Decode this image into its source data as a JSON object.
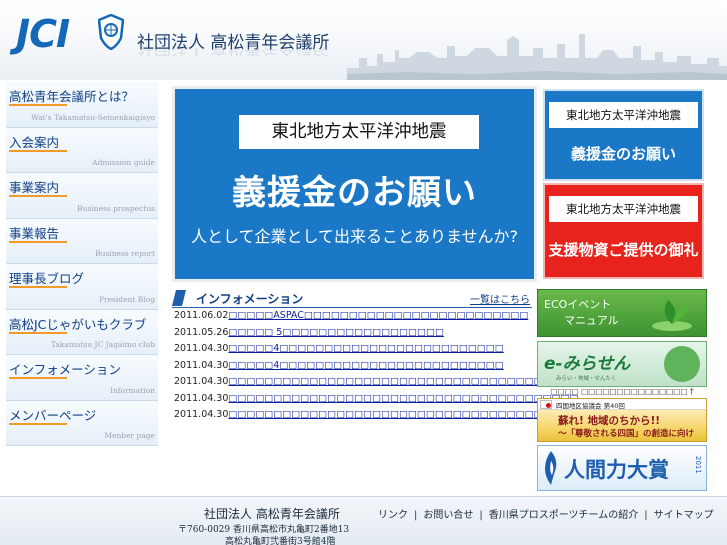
{
  "header": {
    "logo_text": "JCI",
    "org_name": "社団法人 高松青年会議所"
  },
  "sidebar": {
    "items": [
      {
        "label": "高松青年会議所とは？",
        "sub": "Wat's Takamatsu-Seinenkaigisyo"
      },
      {
        "label": "入会案内",
        "sub": "Admission guide"
      },
      {
        "label": "事業案内",
        "sub": "Business prospectus"
      },
      {
        "label": "事業報告",
        "sub": "Business report"
      },
      {
        "label": "理事長ブログ",
        "sub": "President Blog"
      },
      {
        "label": "高松JCじゃがいもクラブ",
        "sub": "Takamatsu JC Jagaimo club"
      },
      {
        "label": "インフォメーション",
        "sub": "Information"
      },
      {
        "label": "メンバーページ",
        "sub": "Menber page"
      }
    ]
  },
  "banner": {
    "title": "東北地方太平洋沖地震",
    "main": "義援金のお願い",
    "sub": "人として企業として出来ることありませんか?"
  },
  "side_boxes": {
    "blue": {
      "title": "東北地方太平洋沖地震",
      "main": "義援金のお願い"
    },
    "red": {
      "title": "東北地方太平洋沖地震",
      "main": "支援物資ご提供の御礼"
    }
  },
  "info": {
    "title": "インフォメーション",
    "more_label": "一覧はこちら",
    "news": [
      {
        "date": "2011.06.02",
        "text": "□□□□□ASPAC□□□□□□□□□□□□□□□□□□□□□□□□□"
      },
      {
        "date": "2011.05.26",
        "text": "□□□□□ 5□□□□□□□□□□□□□□□□□□"
      },
      {
        "date": "2011.04.30",
        "text": "□□□□□4□□□□□□□□□□□□□□□□□□□□□□□□□"
      },
      {
        "date": "2011.04.30",
        "text": "□□□□□4□□□□□□□□□□□□□□□□□□□□□□□□□"
      },
      {
        "date": "2011.04.30",
        "text": "□□□□□□□□□□□□□□□□□□□□□□□□□□□□□□□□□□□□"
      },
      {
        "date": "2011.04.30",
        "text": "□□□□□□□□□□□□□□□□□□□□□□□□□□□□□□□□□□□□□□□"
      },
      {
        "date": "2011.04.30",
        "text": "□□□□□□□□□□□□□□□□□□□□□□□□□□□□□□□□□□□□□□□□"
      }
    ]
  },
  "right_banners": {
    "eco_line1": "ECOイベント",
    "eco_line2": "マニュアル",
    "emirasen_text": "e-みらせん",
    "emirasen_sub": "みらい・地域・せんたく",
    "emirasen_caption": "□□□□ □□□□□□□□□□□□□□□ †",
    "shikoku_label": "四国地区協議会 第40回",
    "shikoku_line1": "蘇れ! 地域のちから!!",
    "shikoku_line2": "〜「尊敬される四国」の創造に向けて〜",
    "ningen_text": "人間力大賞",
    "ningen_year": "2011"
  },
  "footer": {
    "org": "社団法人 高松青年会議所",
    "addr1": "〒760-0029 香川県高松市丸亀町2番地13",
    "addr2": "高松丸亀町弐番街3号館4階",
    "links": [
      "リンク",
      "お問い合せ",
      "香川県プロスポーツチームの紹介",
      "サイトマップ"
    ],
    "separator": "|"
  },
  "colors": {
    "brand_blue": "#1568b8",
    "banner_blue": "#1b78c6",
    "alert_red": "#e8221c",
    "nav_text": "#0f3f86",
    "nav_accent": "#f39b28"
  }
}
